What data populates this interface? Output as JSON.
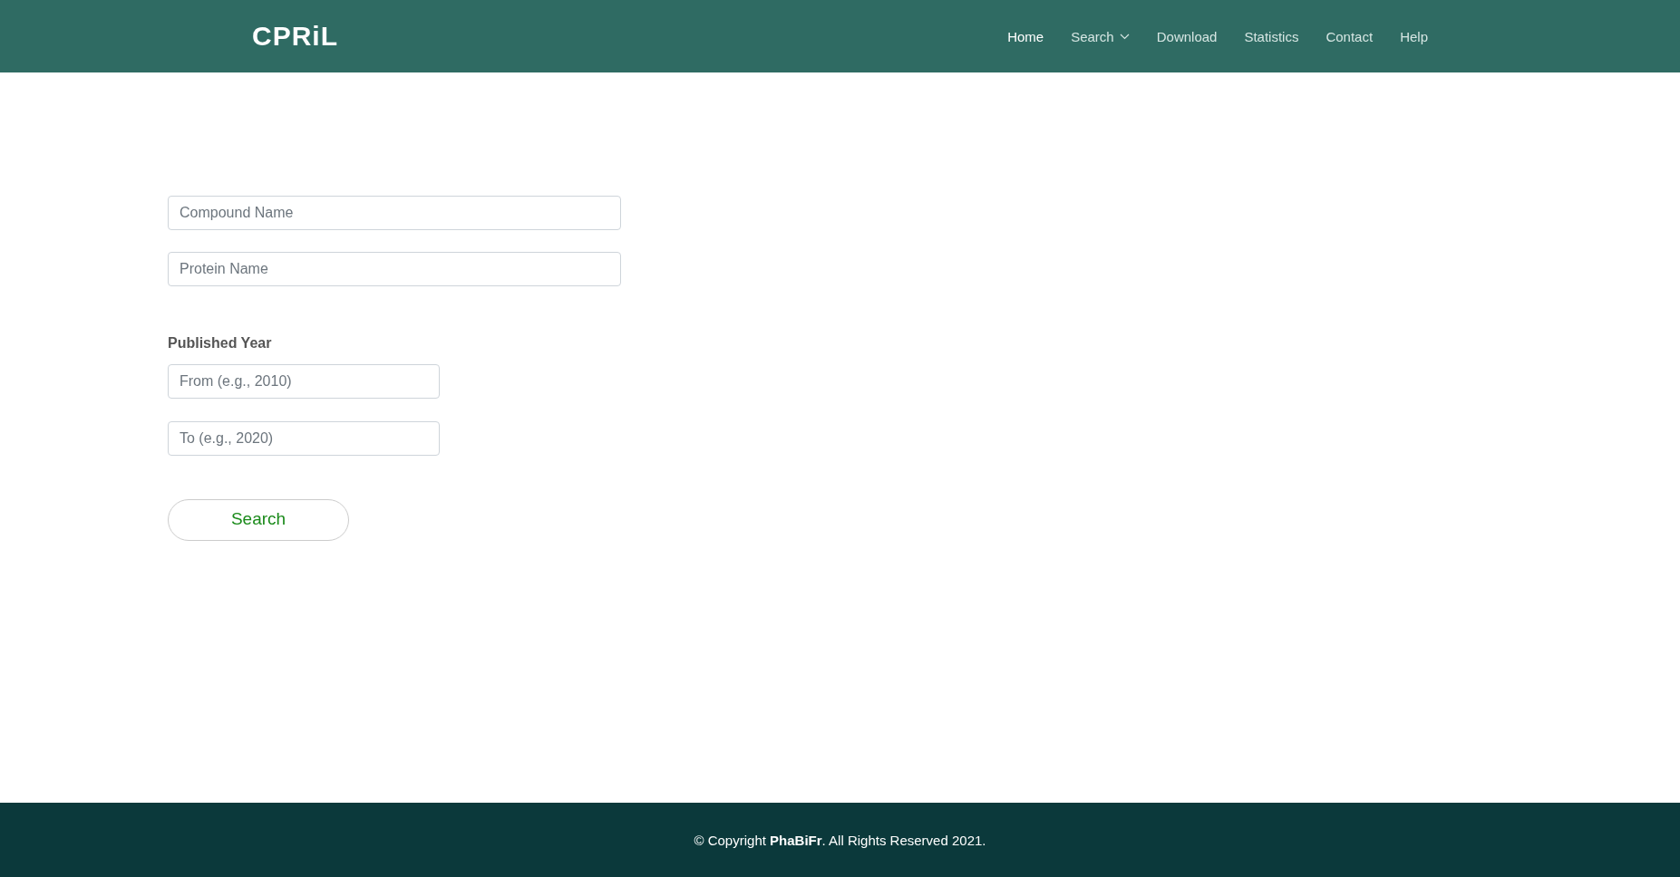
{
  "header": {
    "logo": "CPRiL",
    "nav": [
      {
        "label": "Home",
        "selected": true,
        "kind": "link"
      },
      {
        "label": "Search",
        "selected": false,
        "kind": "dropdown"
      },
      {
        "label": "Download",
        "selected": false,
        "kind": "link"
      },
      {
        "label": "Statistics",
        "selected": false,
        "kind": "link"
      },
      {
        "label": "Contact",
        "selected": false,
        "kind": "link"
      },
      {
        "label": "Help",
        "selected": false,
        "kind": "link"
      }
    ]
  },
  "form": {
    "compound": {
      "placeholder": "Compound Name"
    },
    "protein": {
      "placeholder": "Protein Name"
    },
    "year_label": "Published Year",
    "from": {
      "placeholder": "From (e.g., 2010)"
    },
    "to": {
      "placeholder": "To (e.g., 2020)"
    },
    "button": "Search"
  },
  "footer": {
    "text": "© Copyright **PhaBiFr**. All Rights Reserved 2021."
  }
}
